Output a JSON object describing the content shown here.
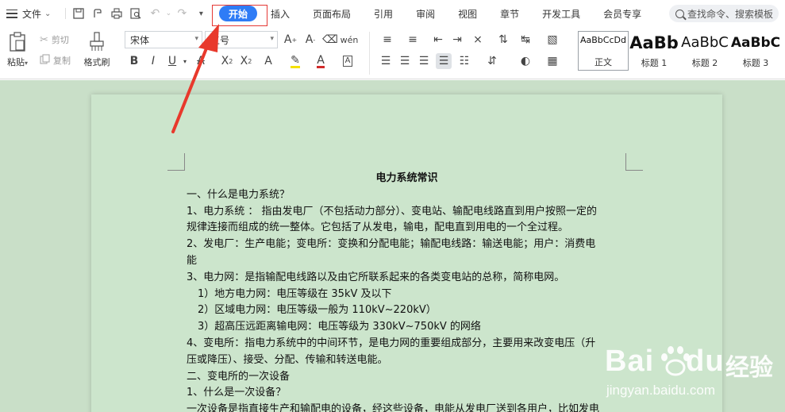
{
  "titlebar": {
    "file_menu_label": "文件",
    "tabs": [
      {
        "label": "开始",
        "active": true
      },
      {
        "label": "插入",
        "active": false
      },
      {
        "label": "页面布局",
        "active": false
      },
      {
        "label": "引用",
        "active": false
      },
      {
        "label": "审阅",
        "active": false
      },
      {
        "label": "视图",
        "active": false
      },
      {
        "label": "章节",
        "active": false
      },
      {
        "label": "开发工具",
        "active": false
      },
      {
        "label": "会员专享",
        "active": false
      }
    ],
    "search_placeholder": "查找命令、搜索模板"
  },
  "ribbon": {
    "paste_label": "粘贴",
    "cut_label": "剪切",
    "copy_label": "复制",
    "format_painter_label": "格式刷",
    "font_name": "宋体",
    "font_size": "五号",
    "styles": [
      {
        "sample": "AaBbCcDd",
        "name": "正文"
      },
      {
        "sample": "AaBb",
        "name": "标题 1"
      },
      {
        "sample": "AaBbC",
        "name": "标题 2"
      },
      {
        "sample": "AaBbC",
        "name": "标题 3"
      }
    ]
  },
  "document": {
    "title": "电力系统常识",
    "lines": [
      "一、什么是电力系统？",
      "1、电力系统 ： 指由发电厂（不包括动力部分）、变电站、输配电线路直到用户按照一定的",
      "规律连接而组成的统一整体。它包括了从发电，输电，配电直到用电的一个全过程。",
      "2、发电厂：生产电能；变电所：变换和分配电能；输配电线路：输送电能；用户：消费电",
      "能",
      "3、电力网：是指输配电线路以及由它所联系起来的各类变电站的总称，简称电网。",
      "1）地方电力网：电压等级在 35kV 及以下",
      "2）区域电力网：电压等级一般为 110kV~220kV）",
      "3）超高压远距离输电网：电压等级为 330kV~750kV 的网络",
      "4、变电所：指电力系统中的中间环节，是电力网的重要组成部分，主要用来改变电压（升",
      "压或降压）、接受、分配、传输和转送电能。",
      "二、变电所的一次设备",
      "1、什么是一次设备？",
      "一次设备是指直接生产和输配电的设备，经这些设备，电能从发电厂送到各用户，比如发电"
    ]
  },
  "watermark": {
    "logo": "Bai",
    "logo_tail": "du",
    "cn": "经验",
    "url": "jingyan.baidu.com"
  },
  "colors": {
    "accent": "#2f7cf6",
    "highlight_box": "#e53935",
    "arrow": "#e8392c",
    "doc_background": "#c9dfc8",
    "page_background": "#cce5cc"
  }
}
